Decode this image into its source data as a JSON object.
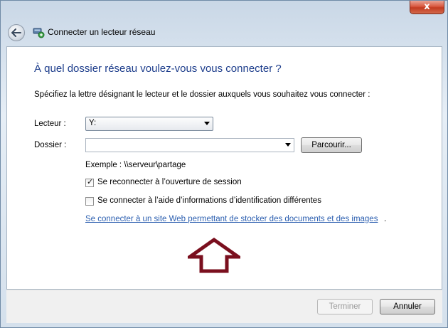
{
  "window": {
    "title": "Connecter un lecteur réseau",
    "close_label": "x"
  },
  "main": {
    "heading": "À quel dossier réseau voulez-vous vous connecter ?",
    "instruction": "Spécifiez la lettre désignant le lecteur et le dossier auxquels vous souhaitez vous connecter :",
    "drive_label": "Lecteur :",
    "drive_value": "Y:",
    "folder_label": "Dossier :",
    "folder_value": "",
    "browse_label": "Parcourir...",
    "example_text": "Exemple : \\\\serveur\\partage",
    "reconnect_label": "Se reconnecter à l’ouverture de session",
    "reconnect_checked": true,
    "other_credentials_label": "Se connecter à l’aide d’informations d’identification différentes",
    "other_credentials_checked": false,
    "web_link_label": "Se connecter à un site Web permettant de stocker des documents et des images",
    "web_link_suffix": "."
  },
  "footer": {
    "finish_label": "Terminer",
    "cancel_label": "Annuler"
  },
  "colors": {
    "heading": "#1e3e8c",
    "link": "#2c5fb0",
    "annotation_arrow": "#7a0f1e"
  },
  "icons": [
    "back-arrow-icon",
    "network-drive-icon",
    "dropdown-arrow-icon",
    "checkmark-icon",
    "up-arrow-annotation-icon"
  ]
}
